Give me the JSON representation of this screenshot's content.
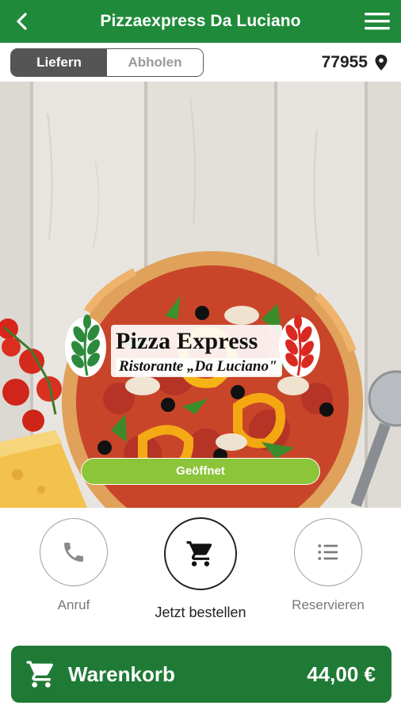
{
  "header": {
    "title": "Pizzaexpress Da Luciano",
    "back_icon": "chevron-left-icon",
    "menu_icon": "hamburger-menu-icon"
  },
  "order_mode": {
    "options": [
      "Liefern",
      "Abholen"
    ],
    "selected": "Liefern"
  },
  "location": {
    "postal_code": "77955",
    "icon": "map-pin-icon"
  },
  "hero": {
    "logo_title": "Pizza Express",
    "logo_subtitle": "Ristorante „Da Luciano\"",
    "status": "Geöffnet"
  },
  "actions": [
    {
      "label": "Anruf",
      "icon": "phone-icon"
    },
    {
      "label": "Jetzt bestellen",
      "icon": "shopping-cart-icon"
    },
    {
      "label": "Reservieren",
      "icon": "list-icon"
    }
  ],
  "cart": {
    "label": "Warenkorb",
    "total": "44,00 €",
    "icon": "shopping-cart-icon"
  },
  "colors": {
    "primary": "#1f8a3a",
    "cart_bar": "#1f7a35",
    "status_open": "#8cc43a",
    "segment_active": "#555555"
  }
}
